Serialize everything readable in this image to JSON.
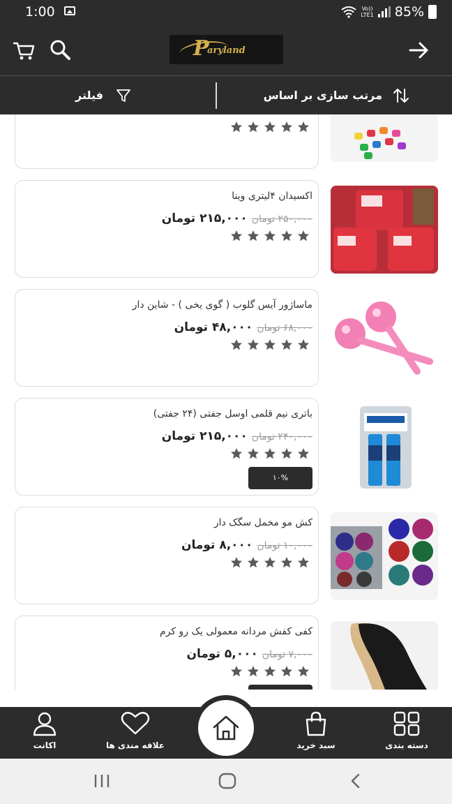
{
  "status_bar": {
    "time": "1:00",
    "network_top": "Vo))",
    "network_bottom": "LTE1",
    "battery": "85%"
  },
  "header": {
    "logo_text": "aryland",
    "logo_initial": "P"
  },
  "filter_bar": {
    "sort_label": "مرتب سازی بر اساس",
    "filter_label": "فیلتر"
  },
  "products": [
    {
      "title": "",
      "old_price": "",
      "new_price": "",
      "rating": 5,
      "image": "colorful-clips"
    },
    {
      "title": "اکسیدان ۴لیتری وینا",
      "old_price": "۲۵۰,۰۰۰ تومان",
      "new_price": "۲۱۵,۰۰۰ تومان",
      "rating": 5,
      "image": "vina-containers"
    },
    {
      "title": "ماساژور آیس گلوب ( گوی یخی ) - شاین دار",
      "old_price": "۶۸,۰۰۰ تومان",
      "new_price": "۴۸,۰۰۰ تومان",
      "rating": 5,
      "image": "pink-ice-globes"
    },
    {
      "title": "باتری نیم قلمی اوسل جفتی (۲۴ جفتی)",
      "old_price": "۲۴۰,۰۰۰ تومان",
      "new_price": "۲۱۵,۰۰۰ تومان",
      "rating": 5,
      "discount": "۱۰%",
      "image": "osel-batteries"
    },
    {
      "title": "کش مو مخمل سگک دار",
      "old_price": "۱۰,۰۰۰ تومان",
      "new_price": "۸,۰۰۰ تومان",
      "rating": 5,
      "image": "velvet-scrunchies"
    },
    {
      "title": "کفی کفش مردانه معمولی یک رو کرم",
      "old_price": "۷,۰۰۰ تومان",
      "new_price": "۵,۰۰۰ تومان",
      "rating": 5,
      "image": "shoe-insoles"
    }
  ],
  "bottom_nav": {
    "account": "اکانت",
    "favorites": "علاقه مندی ها",
    "cart": "سبد خرید",
    "categories": "دسته بندی"
  },
  "colors": {
    "bar_background": "#2c2c2c",
    "star_color": "#5a5a5a",
    "card_border": "#dcdcdc"
  }
}
